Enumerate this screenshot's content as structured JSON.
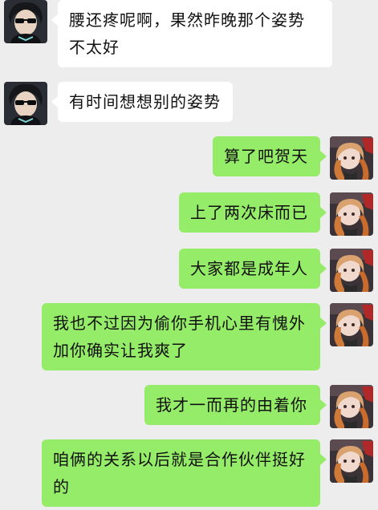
{
  "colors": {
    "background": "#ededed",
    "incoming_bubble": "#ffffff",
    "outgoing_bubble": "#95ec69"
  },
  "messages": [
    {
      "sender": "other",
      "avatar": "anime-boy-sunglasses-avatar",
      "text": "腰还疼呢啊，果然昨晚那个姿势不太好"
    },
    {
      "sender": "other",
      "avatar": "anime-boy-sunglasses-avatar",
      "text": "有时间想想别的姿势"
    },
    {
      "sender": "self",
      "avatar": "anime-girl-avatar",
      "text": "算了吧贺天"
    },
    {
      "sender": "self",
      "avatar": "anime-girl-avatar",
      "text": "上了两次床而已"
    },
    {
      "sender": "self",
      "avatar": "anime-girl-avatar",
      "text": "大家都是成年人"
    },
    {
      "sender": "self",
      "avatar": "anime-girl-avatar",
      "text": "我也不过因为偷你手机心里有愧外加你确实让我爽了"
    },
    {
      "sender": "self",
      "avatar": "anime-girl-avatar",
      "text": "我才一而再的由着你"
    },
    {
      "sender": "self",
      "avatar": "anime-girl-avatar",
      "text": "咱俩的关系以后就是合作伙伴挺好的"
    }
  ]
}
